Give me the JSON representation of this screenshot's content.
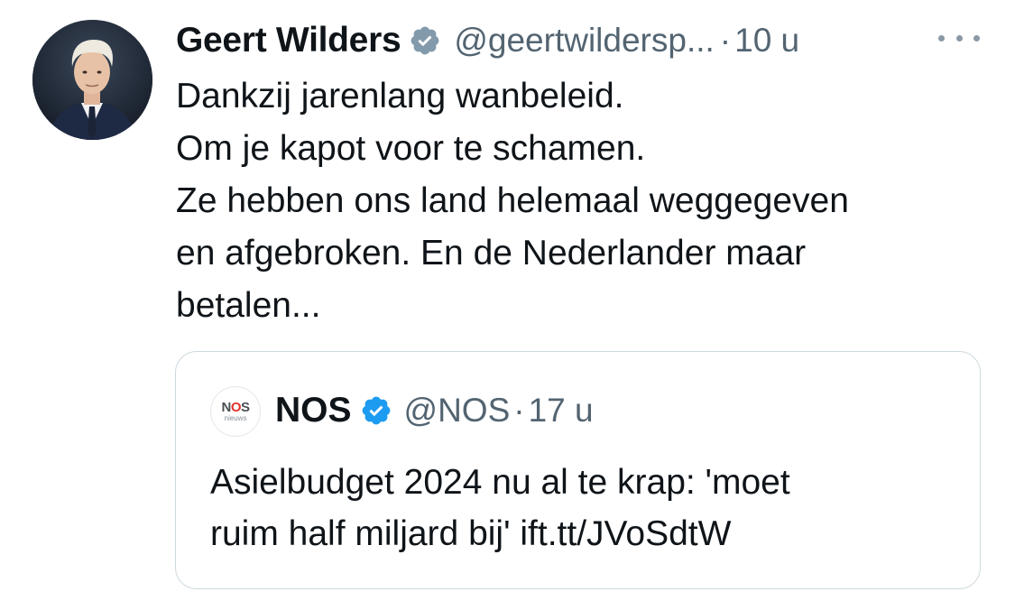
{
  "tweet": {
    "author": {
      "name": "Geert Wilders",
      "handle": "@geertwildersp...",
      "avatar_icon": "person-avatar"
    },
    "separator": "·",
    "time": "10 u",
    "more_icon": "more-horizontal-icon",
    "text_lines": [
      "Dankzij jarenlang wanbeleid.",
      "Om je kapot voor te schamen.",
      "Ze hebben ons land helemaal weggegeven",
      "en afgebroken. En de Nederlander maar",
      "betalen..."
    ],
    "verified_color": "#1d9bf0",
    "quoted": {
      "logo_text": "NOS",
      "logo_subtext": "nieuws",
      "name": "NOS",
      "handle": "@NOS",
      "separator": "·",
      "time": "17 u",
      "text_lines": [
        "Asielbudget 2024 nu al te krap: 'moet",
        "ruim half miljard bij' ift.tt/JVoSdtW"
      ]
    }
  }
}
